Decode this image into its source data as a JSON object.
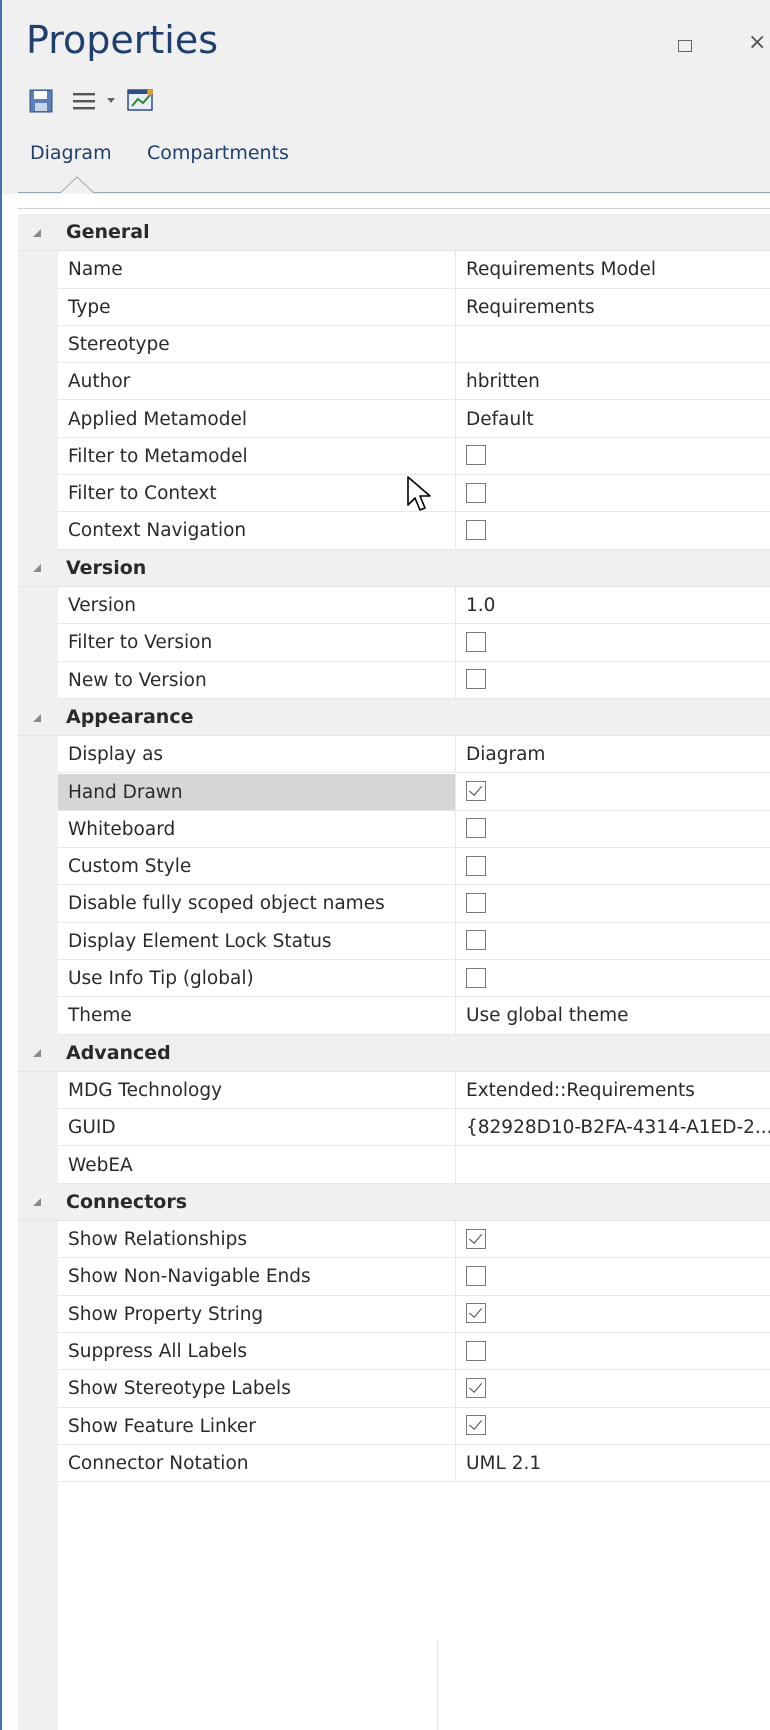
{
  "window": {
    "title": "Properties"
  },
  "tabs": [
    {
      "label": "Diagram",
      "active": true
    },
    {
      "label": "Compartments",
      "active": false
    }
  ],
  "categories": [
    {
      "label": "General",
      "rows": [
        {
          "name": "Name",
          "value": "Requirements Model",
          "type": "text"
        },
        {
          "name": "Type",
          "value": "Requirements",
          "type": "text"
        },
        {
          "name": "Stereotype",
          "value": "",
          "type": "text"
        },
        {
          "name": "Author",
          "value": "hbritten",
          "type": "text"
        },
        {
          "name": "Applied Metamodel",
          "value": "Default",
          "type": "text"
        },
        {
          "name": "Filter to Metamodel",
          "checked": false,
          "type": "checkbox"
        },
        {
          "name": "Filter to Context",
          "checked": false,
          "type": "checkbox"
        },
        {
          "name": "Context Navigation",
          "checked": false,
          "type": "checkbox"
        }
      ]
    },
    {
      "label": "Version",
      "rows": [
        {
          "name": "Version",
          "value": "1.0",
          "type": "text"
        },
        {
          "name": "Filter to Version",
          "checked": false,
          "type": "checkbox"
        },
        {
          "name": "New to Version",
          "checked": false,
          "type": "checkbox"
        }
      ]
    },
    {
      "label": "Appearance",
      "rows": [
        {
          "name": "Display as",
          "value": "Diagram",
          "type": "text"
        },
        {
          "name": "Hand Drawn",
          "checked": true,
          "type": "checkbox",
          "selected": true
        },
        {
          "name": "Whiteboard",
          "checked": false,
          "type": "checkbox"
        },
        {
          "name": "Custom Style",
          "checked": false,
          "type": "checkbox"
        },
        {
          "name": "Disable fully scoped object names",
          "checked": false,
          "type": "checkbox"
        },
        {
          "name": "Display Element Lock Status",
          "checked": false,
          "type": "checkbox"
        },
        {
          "name": "Use Info Tip (global)",
          "checked": false,
          "type": "checkbox"
        },
        {
          "name": "Theme",
          "value": "Use global theme",
          "type": "text"
        }
      ]
    },
    {
      "label": "Advanced",
      "rows": [
        {
          "name": "MDG Technology",
          "value": "Extended::Requirements",
          "type": "text"
        },
        {
          "name": "GUID",
          "value": "{82928D10-B2FA-4314-A1ED-2...",
          "type": "text"
        },
        {
          "name": "WebEA",
          "value": "",
          "type": "text"
        }
      ]
    },
    {
      "label": "Connectors",
      "rows": [
        {
          "name": "Show Relationships",
          "checked": true,
          "type": "checkbox"
        },
        {
          "name": "Show Non-Navigable Ends",
          "checked": false,
          "type": "checkbox"
        },
        {
          "name": "Show Property String",
          "checked": true,
          "type": "checkbox"
        },
        {
          "name": "Suppress All Labels",
          "checked": false,
          "type": "checkbox"
        },
        {
          "name": "Show Stereotype Labels",
          "checked": true,
          "type": "checkbox"
        },
        {
          "name": "Show Feature Linker",
          "checked": true,
          "type": "checkbox"
        },
        {
          "name": "Connector Notation",
          "value": "UML 2.1",
          "type": "text"
        }
      ]
    }
  ],
  "icons": {
    "save": "save-icon",
    "menu": "menu-icon",
    "dropdown": "dropdown-arrow-icon",
    "diagram": "diagram-icon",
    "restore": "restore-icon",
    "close": "close-icon",
    "collapse": "collapse-arrow-icon"
  },
  "colors": {
    "title": "#1f3f6e",
    "header_bg": "#f0f0f0",
    "selected_row": "#d6d6d6"
  }
}
